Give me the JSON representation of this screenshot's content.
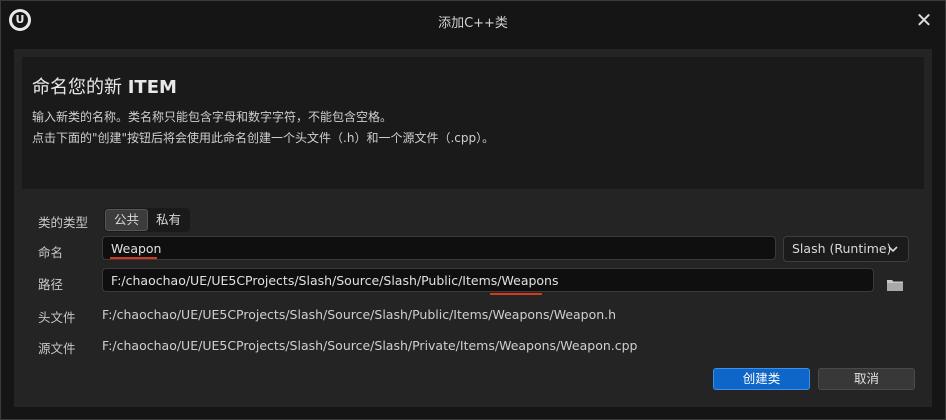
{
  "window": {
    "title": "添加C++类",
    "logo_text": "U",
    "close_glyph": "✕"
  },
  "header": {
    "title_prefix": "命名您的新",
    "title_item": "ITEM",
    "desc_line1": "输入新类的名称。类名称只能包含字母和数字字符，不能包含空格。",
    "desc_line2": "点击下面的\"创建\"按钮后将会使用此命名创建一个头文件（.h）和一个源文件（.cpp）。"
  },
  "class_type": {
    "label": "类的类型",
    "options": [
      "公共",
      "私有"
    ],
    "selected": "公共"
  },
  "name": {
    "label": "命名",
    "value": "Weapon"
  },
  "module": {
    "value": "Slash (Runtime)",
    "chevron": "⌄"
  },
  "path": {
    "label": "路径",
    "value_prefix": "F:/chaochao/UE/UE5CProjects/Slash/Source/Slash/Public/Items/",
    "value_highlight": "Weapons"
  },
  "header_file": {
    "label": "头文件",
    "value": "F:/chaochao/UE/UE5CProjects/Slash/Source/Slash/Public/Items/Weapons/Weapon.h"
  },
  "source_file": {
    "label": "源文件",
    "value": "F:/chaochao/UE/UE5CProjects/Slash/Source/Slash/Private/Items/Weapons/Weapon.cpp"
  },
  "buttons": {
    "create": "创建类",
    "cancel": "取消"
  },
  "colors": {
    "accent": "#0f66c9",
    "underline": "#d23a1f"
  },
  "icons": {
    "logo": "unreal-logo-icon",
    "close": "close-icon",
    "folder": "folder-icon",
    "chevron": "chevron-down-icon"
  }
}
